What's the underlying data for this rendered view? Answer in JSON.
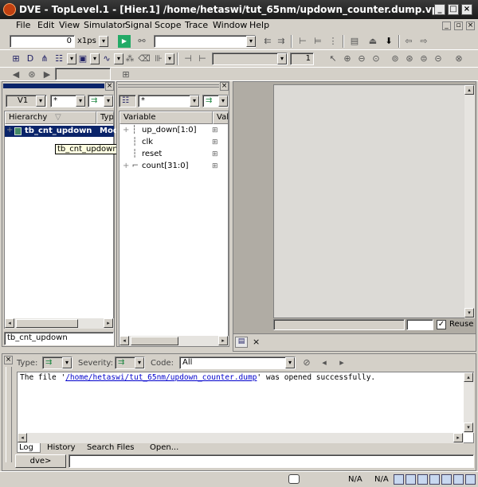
{
  "window": {
    "title": "DVE - TopLevel.1 - [Hier.1]  /home/hetaswi/tut_65nm/updown_counter.dump.vpd"
  },
  "menu": [
    "File",
    "Edit",
    "View",
    "Simulator",
    "Signal",
    "Scope",
    "Trace",
    "Window",
    "Help"
  ],
  "toolbar1": {
    "time_value": "0",
    "time_unit": "x1ps"
  },
  "toolbar2": {
    "page_value": "1"
  },
  "hier_panel": {
    "view_select": "V1",
    "filter": "*",
    "col_hierarchy": "Hierarchy",
    "col_type": "Typ",
    "rows": [
      {
        "name": "tb_cnt_updown",
        "type": "Mod"
      }
    ],
    "tooltip": "tb_cnt_updown",
    "bottom_field": "tb_cnt_updown"
  },
  "var_panel": {
    "filter": "*",
    "col_variable": "Variable",
    "col_value": "Val",
    "rows": [
      {
        "name": "up_down[1:0]",
        "expand": "+"
      },
      {
        "name": "clk",
        "expand": ""
      },
      {
        "name": "reset",
        "expand": ""
      },
      {
        "name": "count[31:0]",
        "expand": "+"
      }
    ]
  },
  "wave": {
    "reuse_label": "Reuse",
    "reuse_checked": true
  },
  "console": {
    "type_label": "Type:",
    "severity_label": "Severity:",
    "code_label": "Code:",
    "code_value": "All",
    "log_prefix": "The file '",
    "log_link": "/home/hetaswi/tut_65nm/updown_counter.dump",
    "log_suffix": "' was opened successfully.",
    "tabs": [
      "Log",
      "History",
      "Search Files",
      "Open..."
    ],
    "prompt": "dve>"
  },
  "status": {
    "na1": "N/A",
    "na2": "N/A"
  },
  "colors": {
    "selection": "#0a246a",
    "link": "#0000cc",
    "title_bg": "#2a2a2a"
  }
}
